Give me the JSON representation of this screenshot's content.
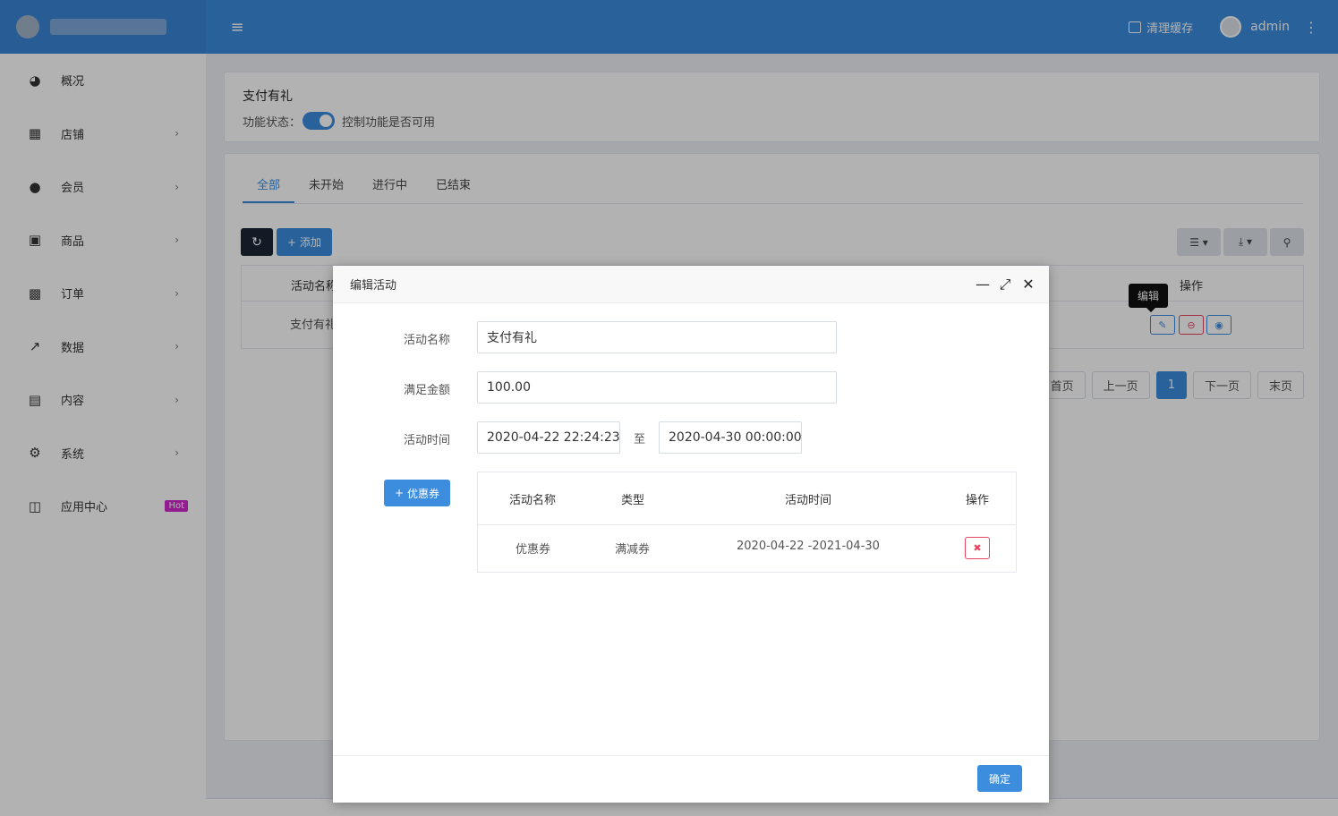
{
  "header": {
    "clear_cache": "清理缓存",
    "user": "admin"
  },
  "sidebar": {
    "items": [
      {
        "label": "概况",
        "icon": "dashboard-icon",
        "has_children": false
      },
      {
        "label": "店铺",
        "icon": "grid-icon",
        "has_children": true
      },
      {
        "label": "会员",
        "icon": "users-icon",
        "has_children": true
      },
      {
        "label": "商品",
        "icon": "cart-icon",
        "has_children": true
      },
      {
        "label": "订单",
        "icon": "money-icon",
        "has_children": true
      },
      {
        "label": "数据",
        "icon": "line-chart-icon",
        "has_children": true
      },
      {
        "label": "内容",
        "icon": "file-icon",
        "has_children": true
      },
      {
        "label": "系统",
        "icon": "gear-icon",
        "has_children": true
      },
      {
        "label": "应用中心",
        "icon": "cube-icon",
        "badge": "Hot"
      }
    ]
  },
  "feature": {
    "title": "支付有礼",
    "status_label": "功能状态：",
    "status_hint": "控制功能是否可用",
    "enabled": true
  },
  "tabs": [
    {
      "label": "全部",
      "active": true
    },
    {
      "label": "未开始",
      "active": false
    },
    {
      "label": "进行中",
      "active": false
    },
    {
      "label": "已结束",
      "active": false
    }
  ],
  "toolbar": {
    "add_label": "添加"
  },
  "list": {
    "columns": [
      "活动名称",
      "操作"
    ],
    "rows": [
      {
        "name": "支付有礼"
      }
    ],
    "tooltip": "编辑"
  },
  "pagination": {
    "first": "首页",
    "prev": "上一页",
    "current": "1",
    "next": "下一页",
    "last": "末页"
  },
  "modal": {
    "title": "编辑活动",
    "fields": {
      "name_label": "活动名称",
      "name_value": "支付有礼",
      "amount_label": "满足金额",
      "amount_value": "100.00",
      "time_label": "活动时间",
      "time_start": "2020-04-22 22:24:23",
      "time_to": "至",
      "time_end": "2020-04-30 00:00:00"
    },
    "coupon_button": "优惠券",
    "coupon_table": {
      "columns": [
        "活动名称",
        "类型",
        "活动时间",
        "操作"
      ],
      "rows": [
        {
          "name": "优惠券",
          "type": "满减券",
          "time": "2020-04-22 -2021-04-30"
        }
      ]
    },
    "ok_label": "确定"
  },
  "colors": {
    "primary": "#3c8dde",
    "danger": "#e6445f",
    "dark": "#1a2636",
    "hot": "#d02acc"
  }
}
